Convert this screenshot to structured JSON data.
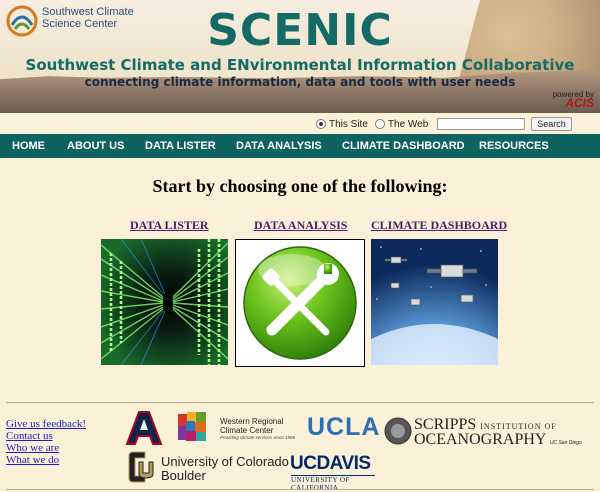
{
  "header": {
    "org_name_line1": "Southwest Climate",
    "org_name_line2": "Science Center",
    "title": "SCENIC",
    "subtitle": "Southwest Climate and ENvironmental Information Collaborative",
    "tagline": "connecting climate information, data and tools with user needs",
    "powered_by": "powered by",
    "powered_brand": "ACIS"
  },
  "search": {
    "option_site": "This Site",
    "option_web": "The Web",
    "selected": "This Site",
    "input_value": "",
    "button_label": "Search"
  },
  "nav": {
    "items": [
      {
        "label": "HOME"
      },
      {
        "label": "ABOUT US"
      },
      {
        "label": "DATA LISTER"
      },
      {
        "label": "DATA ANALYSIS"
      },
      {
        "label": "CLIMATE DASHBOARD"
      },
      {
        "label": "RESOURCES"
      }
    ],
    "colors": {
      "bar": "#0e6360",
      "text": "#ffffff"
    }
  },
  "main": {
    "headline": "Start by choosing one of the following:",
    "choices": [
      {
        "label": "DATA LISTER",
        "icon": "matrix-data-icon"
      },
      {
        "label": "DATA ANALYSIS",
        "icon": "wrench-screwdriver-icon"
      },
      {
        "label": "CLIMATE DASHBOARD",
        "icon": "satellites-icon"
      }
    ]
  },
  "footer": {
    "links": [
      "Give us feedback!",
      "Contact us",
      "Who we are",
      "What we do"
    ],
    "partners": {
      "ua": "University of Arizona",
      "wrcc_name": "Western Regional\nClimate Center",
      "wrcc_tag": "Providing climate services since 1986",
      "ucla": "UCLA",
      "scripps_line1": "SCRIPPS",
      "scripps_line1_small": "INSTITUTION OF",
      "scripps_line2": "OCEANOGRAPHY",
      "scripps_ucsd": "UC San Diego",
      "cu_line1": "University of Colorado",
      "cu_line2": "Boulder",
      "ucdavis": "UCDAVIS",
      "ucdavis_sub": "UNIVERSITY OF CALIFORNIA"
    }
  }
}
